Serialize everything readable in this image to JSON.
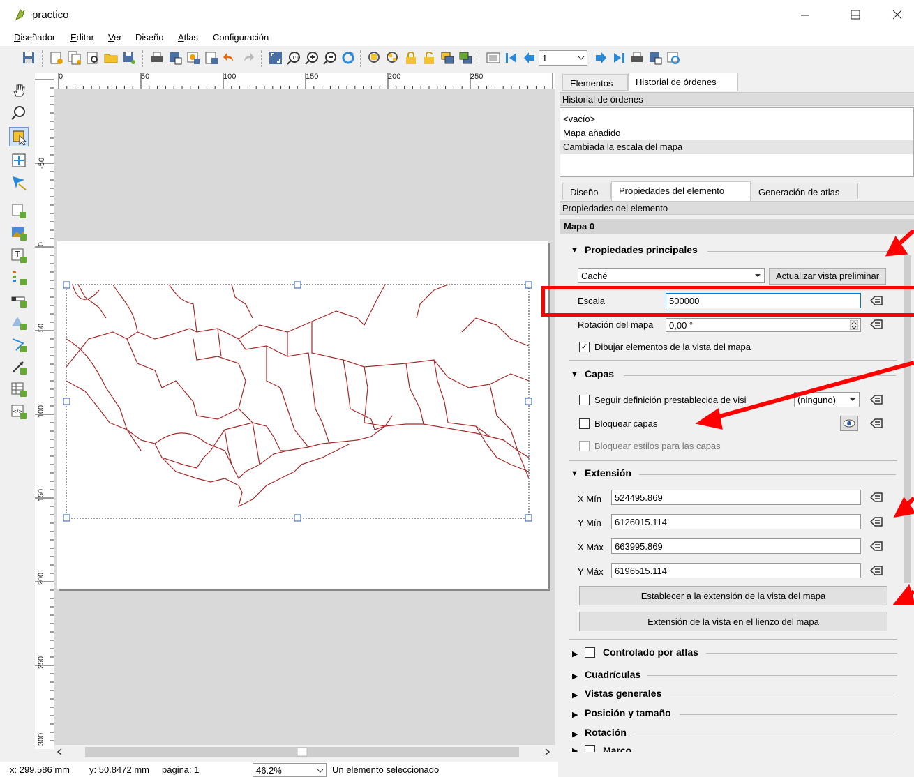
{
  "window": {
    "title": "practico",
    "min_label": "—",
    "max_label": "☐",
    "close_label": "✕"
  },
  "menu": [
    {
      "label": "Diseñador",
      "u": "D",
      "rest": "iseñador"
    },
    {
      "label": "Editar",
      "u": "E",
      "rest": "ditar"
    },
    {
      "label": "Ver",
      "u": "V",
      "rest": "er"
    },
    {
      "label": "Diseño",
      "u": "",
      "rest": "Diseño"
    },
    {
      "label": "Atlas",
      "u": "A",
      "rest": "tlas"
    },
    {
      "label": "Configuración",
      "u": "",
      "rest": "Configuración"
    }
  ],
  "toolbar": {
    "page_value": "1"
  },
  "ruler_top": [
    "0",
    "50",
    "100",
    "150",
    "200",
    "250"
  ],
  "ruler_left": [
    "-50",
    "0",
    "50",
    "100",
    "150",
    "200",
    "250",
    "300"
  ],
  "status": {
    "x": "x: 299.586 mm",
    "y": "y: 50.8472 mm",
    "page": "página: 1",
    "zoom": "46.2%",
    "selection": "Un elemento seleccionado"
  },
  "top_tabs": {
    "elements": "Elementos",
    "history": "Historial de órdenes"
  },
  "history": {
    "title": "Historial de órdenes",
    "items": [
      "<vacío>",
      "Mapa añadido",
      "Cambiada la escala del mapa"
    ]
  },
  "mid_tabs": {
    "layout": "Diseño",
    "item_props": "Propiedades del elemento",
    "atlas": "Generación de atlas"
  },
  "props": {
    "panel_title": "Propiedades del elemento",
    "item_name": "Mapa 0",
    "main_group": "Propiedades principales",
    "cache_option": "Caché",
    "update_preview": "Actualizar vista preliminar",
    "scale_label": "Escala",
    "scale_value": "500000",
    "rotation_label": "Rotación del mapa",
    "rotation_value": "0,00 °",
    "draw_items_label": "Dibujar elementos de la vista del mapa",
    "layers_group": "Capas",
    "follow_preset_label": "Seguir definición prestablecida de visi",
    "preset_value": "(ninguno)",
    "lock_layers_label": "Bloquear capas",
    "lock_styles_label": "Bloquear estilos para las capas",
    "extent_group": "Extensión",
    "xmin_label": "X Mín",
    "xmin_value": "524495.869",
    "ymin_label": "Y Mín",
    "ymin_value": "6126015.114",
    "xmax_label": "X Máx",
    "xmax_value": "663995.869",
    "ymax_label": "Y Máx",
    "ymax_value": "6196515.114",
    "set_extent_btn": "Establecer a la extensión de la vista del mapa",
    "view_extent_btn": "Extensión de la vista en el lienzo del mapa",
    "atlas_controlled": "Controlado por atlas",
    "grids": "Cuadrículas",
    "overviews": "Vistas generales",
    "position_size": "Posición y tamaño",
    "rotation": "Rotación",
    "frame": "Marco"
  },
  "colors": {
    "annotation": "#ff0000",
    "map_lines": "#a52a2a",
    "accent": "#0078d7"
  }
}
